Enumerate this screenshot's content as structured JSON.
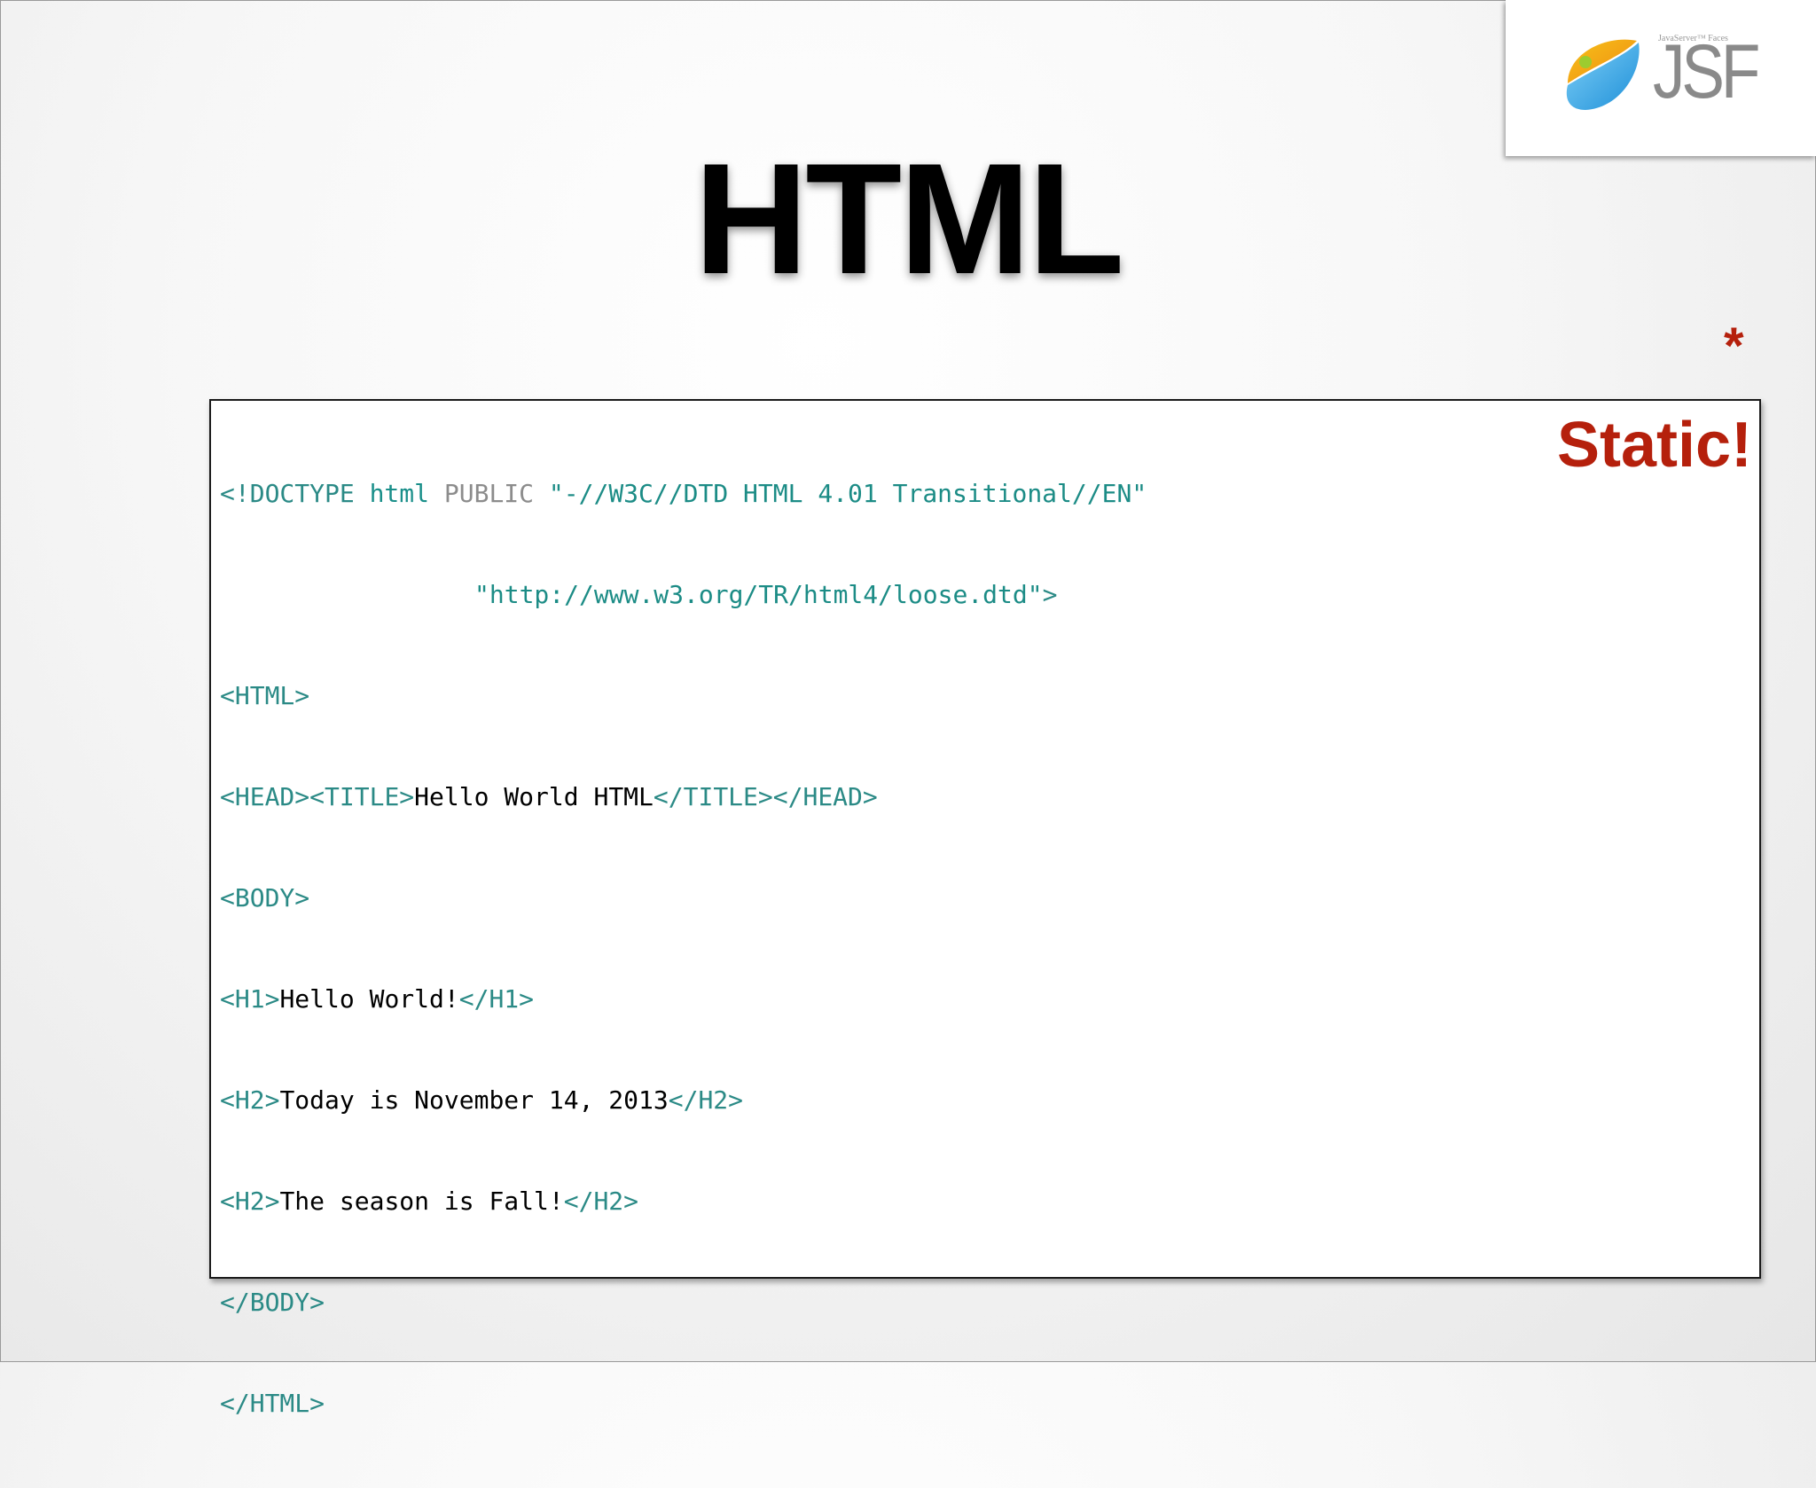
{
  "slide": {
    "title": "HTML",
    "asterisk": "*",
    "static_label": "Static!"
  },
  "logo": {
    "tagline": "JavaServer™ Faces",
    "letters": "JSF"
  },
  "code": {
    "line1": {
      "open": "<!DOCTYPE",
      "sp1": " ",
      "html": "html",
      "sp2": " ",
      "public": "PUBLIC",
      "sp3": " ",
      "fpi": "\"-//W3C//DTD HTML 4.01 Transitional//EN\""
    },
    "line2": {
      "url": "\"http://www.w3.org/TR/html4/loose.dtd\"",
      "close": ">"
    },
    "line3": "<HTML>",
    "line4": {
      "head_open": "<HEAD>",
      "title_open": "<TITLE>",
      "text": "Hello World HTML",
      "title_close": "</TITLE>",
      "head_close": "</HEAD>"
    },
    "line5": "<BODY>",
    "line6": {
      "open": "<H1>",
      "text": "Hello World!",
      "close": "</H1>"
    },
    "line7": {
      "open": "<H2>",
      "text": "Today is November 14, 2013",
      "close": "</H2>"
    },
    "line8": {
      "open": "<H2>",
      "text": "The season is Fall!",
      "close": "</H2>"
    },
    "line9": "</BODY>",
    "line10": "</HTML>"
  },
  "colors": {
    "accent_red": "#b5200c",
    "code_tag": "#2b8a86",
    "code_muted": "#8c8c8c"
  }
}
